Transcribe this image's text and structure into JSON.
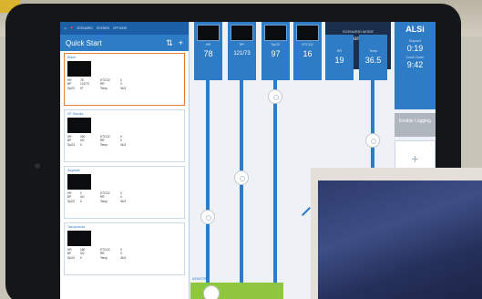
{
  "status_bar": {
    "scenario_label": "SCENARIO",
    "scenarios_label": "SCENES",
    "options_label": "OPTIONS"
  },
  "quick_start": {
    "title": "Quick Start",
    "cards": [
      {
        "name": "Blank",
        "stats": [
          [
            "HR",
            "78",
            "ETCO2",
            "0"
          ],
          [
            "BP",
            "121/73",
            "RR",
            "0"
          ],
          [
            "SpO2",
            "97",
            "Temp",
            "36.5"
          ]
        ]
      },
      {
        "name": "VF Shocks",
        "sub": "VF Shockable",
        "stats": [
          [
            "HR",
            "300",
            "ETCO2",
            "0"
          ],
          [
            "BP",
            "0/0",
            "RR",
            "0"
          ],
          [
            "SpO2",
            "0",
            "Temp",
            "36.5"
          ]
        ]
      },
      {
        "name": "Asystole",
        "sub": "Asys",
        "stats": [
          [
            "HR",
            "0",
            "ETCO2",
            "0"
          ],
          [
            "BP",
            "0/0",
            "RR",
            "0"
          ],
          [
            "SpO2",
            "0",
            "Temp",
            "36.5"
          ]
        ]
      },
      {
        "name": "Tachycardia",
        "sub": "Tachy",
        "stats": [
          [
            "HR",
            "180",
            "ETCO2",
            "0"
          ],
          [
            "BP",
            "0/0",
            "RR",
            "0"
          ],
          [
            "SpO2",
            "0",
            "Temp",
            "36.5"
          ]
        ]
      }
    ]
  },
  "vitals": [
    {
      "label": "HR",
      "value": "78"
    },
    {
      "label": "BP",
      "value": "121/73"
    },
    {
      "label": "SpO2",
      "value": "97"
    },
    {
      "label": "ETCO2",
      "value": "16"
    },
    {
      "label": "RR",
      "value": "19"
    },
    {
      "label": "Temp",
      "value": "36.5"
    }
  ],
  "scenario": {
    "line1": "SCENARIO MODE",
    "line2": "Monitor"
  },
  "alsi": {
    "title": "ALSi",
    "elapsed_label": "Elapsed",
    "elapsed_value": "0:19",
    "countdown_label": "Count Down",
    "countdown_value": "9:42",
    "enable_label": "Enable Logging",
    "add_symbol": "+"
  },
  "bottom": {
    "label": "MONITOR"
  },
  "icons": [
    "sort-icon",
    "add-icon",
    "battery-icon",
    "heart-icon"
  ],
  "colors": {
    "accent": "#2f7cc6",
    "active_card": "#e07e3a",
    "green": "#8ec63f"
  }
}
